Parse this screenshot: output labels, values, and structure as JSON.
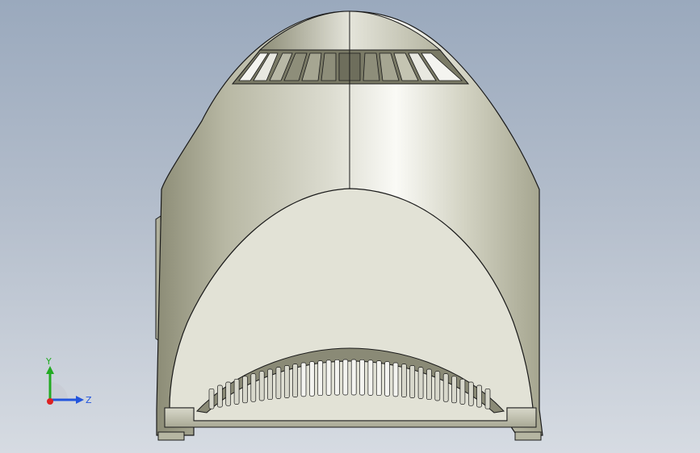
{
  "viewport": {
    "background_top": "#9aa9bd",
    "background_bottom": "#d6dbe2"
  },
  "model": {
    "shell_light": "#f2f2ec",
    "shell_mid": "#c8c8b8",
    "shell_dark": "#7e7e6a",
    "panel_color": "#e2e2d8",
    "edge_color": "#1a1a1a",
    "vent_dark": "#5a5a4c",
    "vent_light": "#f4f4f0"
  },
  "triad": {
    "y_label": "Y",
    "z_label": "Z",
    "y_color": "#22aa22",
    "z_color": "#2255dd",
    "x_color": "#dd2222"
  }
}
